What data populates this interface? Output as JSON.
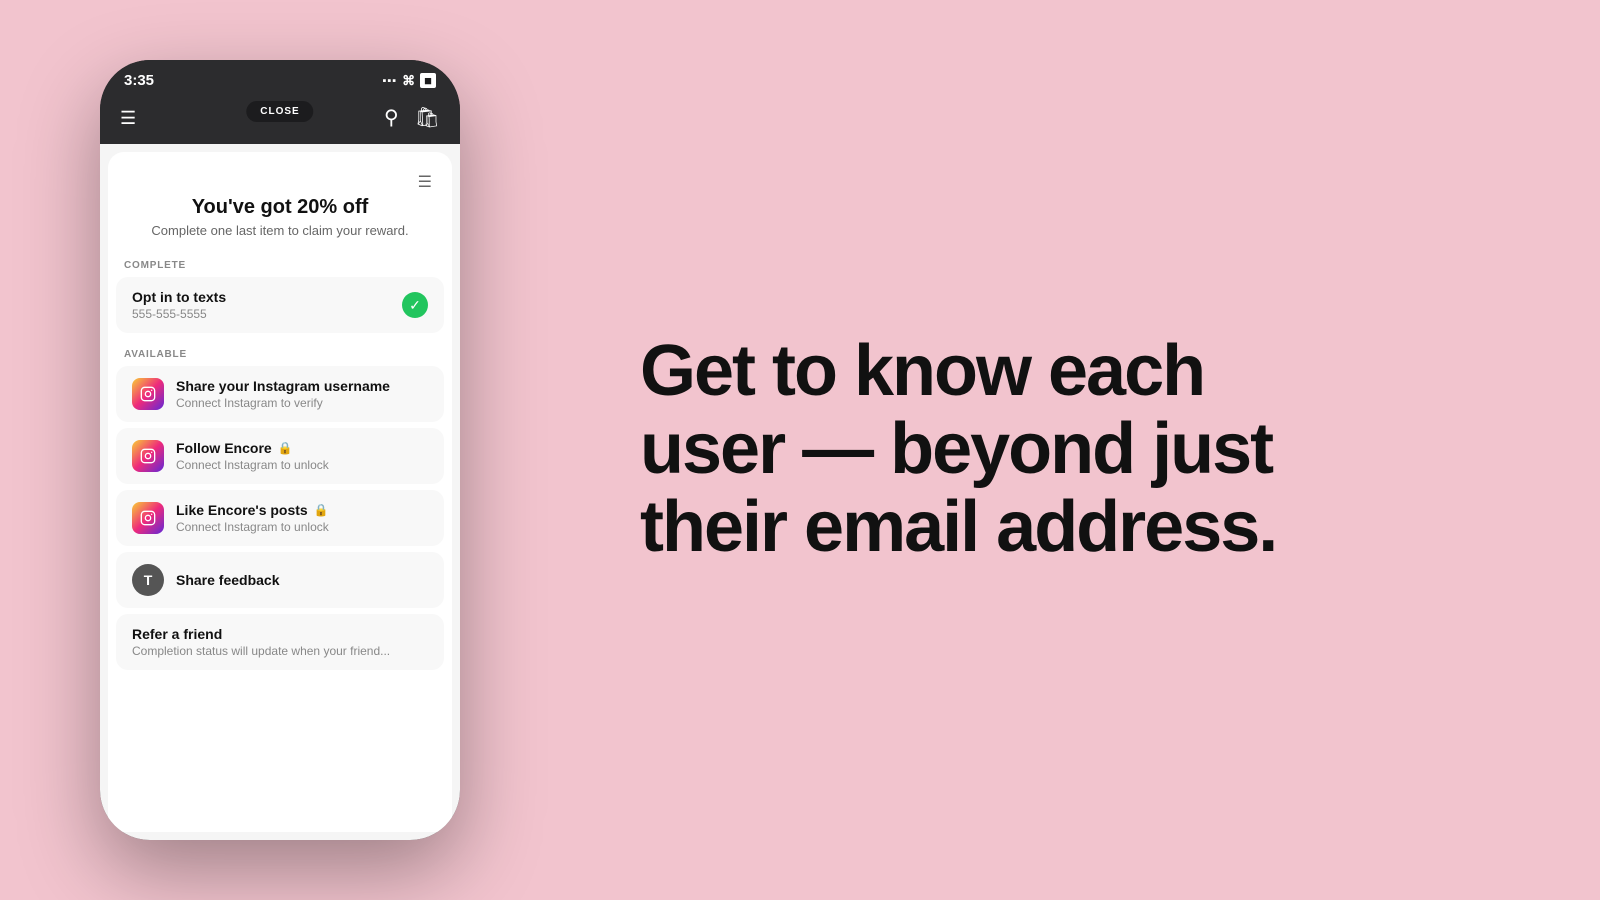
{
  "background_color": "#f2c4ce",
  "phone": {
    "status_bar": {
      "time": "3:35",
      "signal": "▪▪▪",
      "wifi": "wifi",
      "battery": "battery"
    },
    "nav": {
      "close_label": "CLOSE"
    },
    "reward": {
      "title": "You've got 20% off",
      "subtitle": "Complete one last item to claim your reward."
    },
    "sections": {
      "complete_label": "COMPLETE",
      "available_label": "AVAILABLE"
    },
    "tasks": {
      "completed": [
        {
          "title": "Opt in to texts",
          "subtitle": "555-555-5555",
          "icon_type": "check"
        }
      ],
      "available": [
        {
          "title": "Share your Instagram username",
          "subtitle": "Connect Instagram to verify",
          "icon_type": "instagram",
          "locked": false
        },
        {
          "title": "Follow Encore",
          "subtitle": "Connect Instagram to unlock",
          "icon_type": "instagram",
          "locked": true
        },
        {
          "title": "Like Encore's posts",
          "subtitle": "Connect Instagram to unlock",
          "icon_type": "instagram",
          "locked": true
        },
        {
          "title": "Share feedback",
          "subtitle": "",
          "icon_type": "avatar",
          "avatar_letter": "T",
          "locked": false
        },
        {
          "title": "Refer a friend",
          "subtitle": "Completion status will update when your friend...",
          "icon_type": "none",
          "locked": false
        }
      ]
    }
  },
  "headline": {
    "line1": "Get to know each",
    "line2": "user — beyond just",
    "line3": "their email address."
  }
}
